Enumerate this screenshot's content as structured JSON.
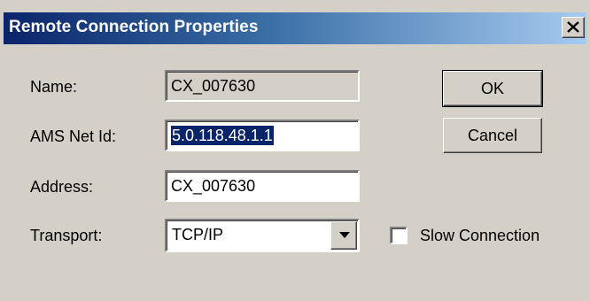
{
  "window": {
    "title": "Remote Connection Properties",
    "close_icon": "close-icon"
  },
  "form": {
    "name_label": "Name:",
    "name_value": "CX_007630",
    "ams_label": "AMS Net Id:",
    "ams_value": "5.0.118.48.1.1",
    "address_label": "Address:",
    "address_value": "CX_007630",
    "transport_label": "Transport:",
    "transport_value": "TCP/IP",
    "slow_connection_label": "Slow Connection",
    "slow_connection_checked": false
  },
  "buttons": {
    "ok_label": "OK",
    "cancel_label": "Cancel"
  },
  "colors": {
    "dialog_bg": "#d4d0c8",
    "title_start": "#0a246a",
    "title_end": "#a6caf0",
    "selection": "#0a246a"
  }
}
